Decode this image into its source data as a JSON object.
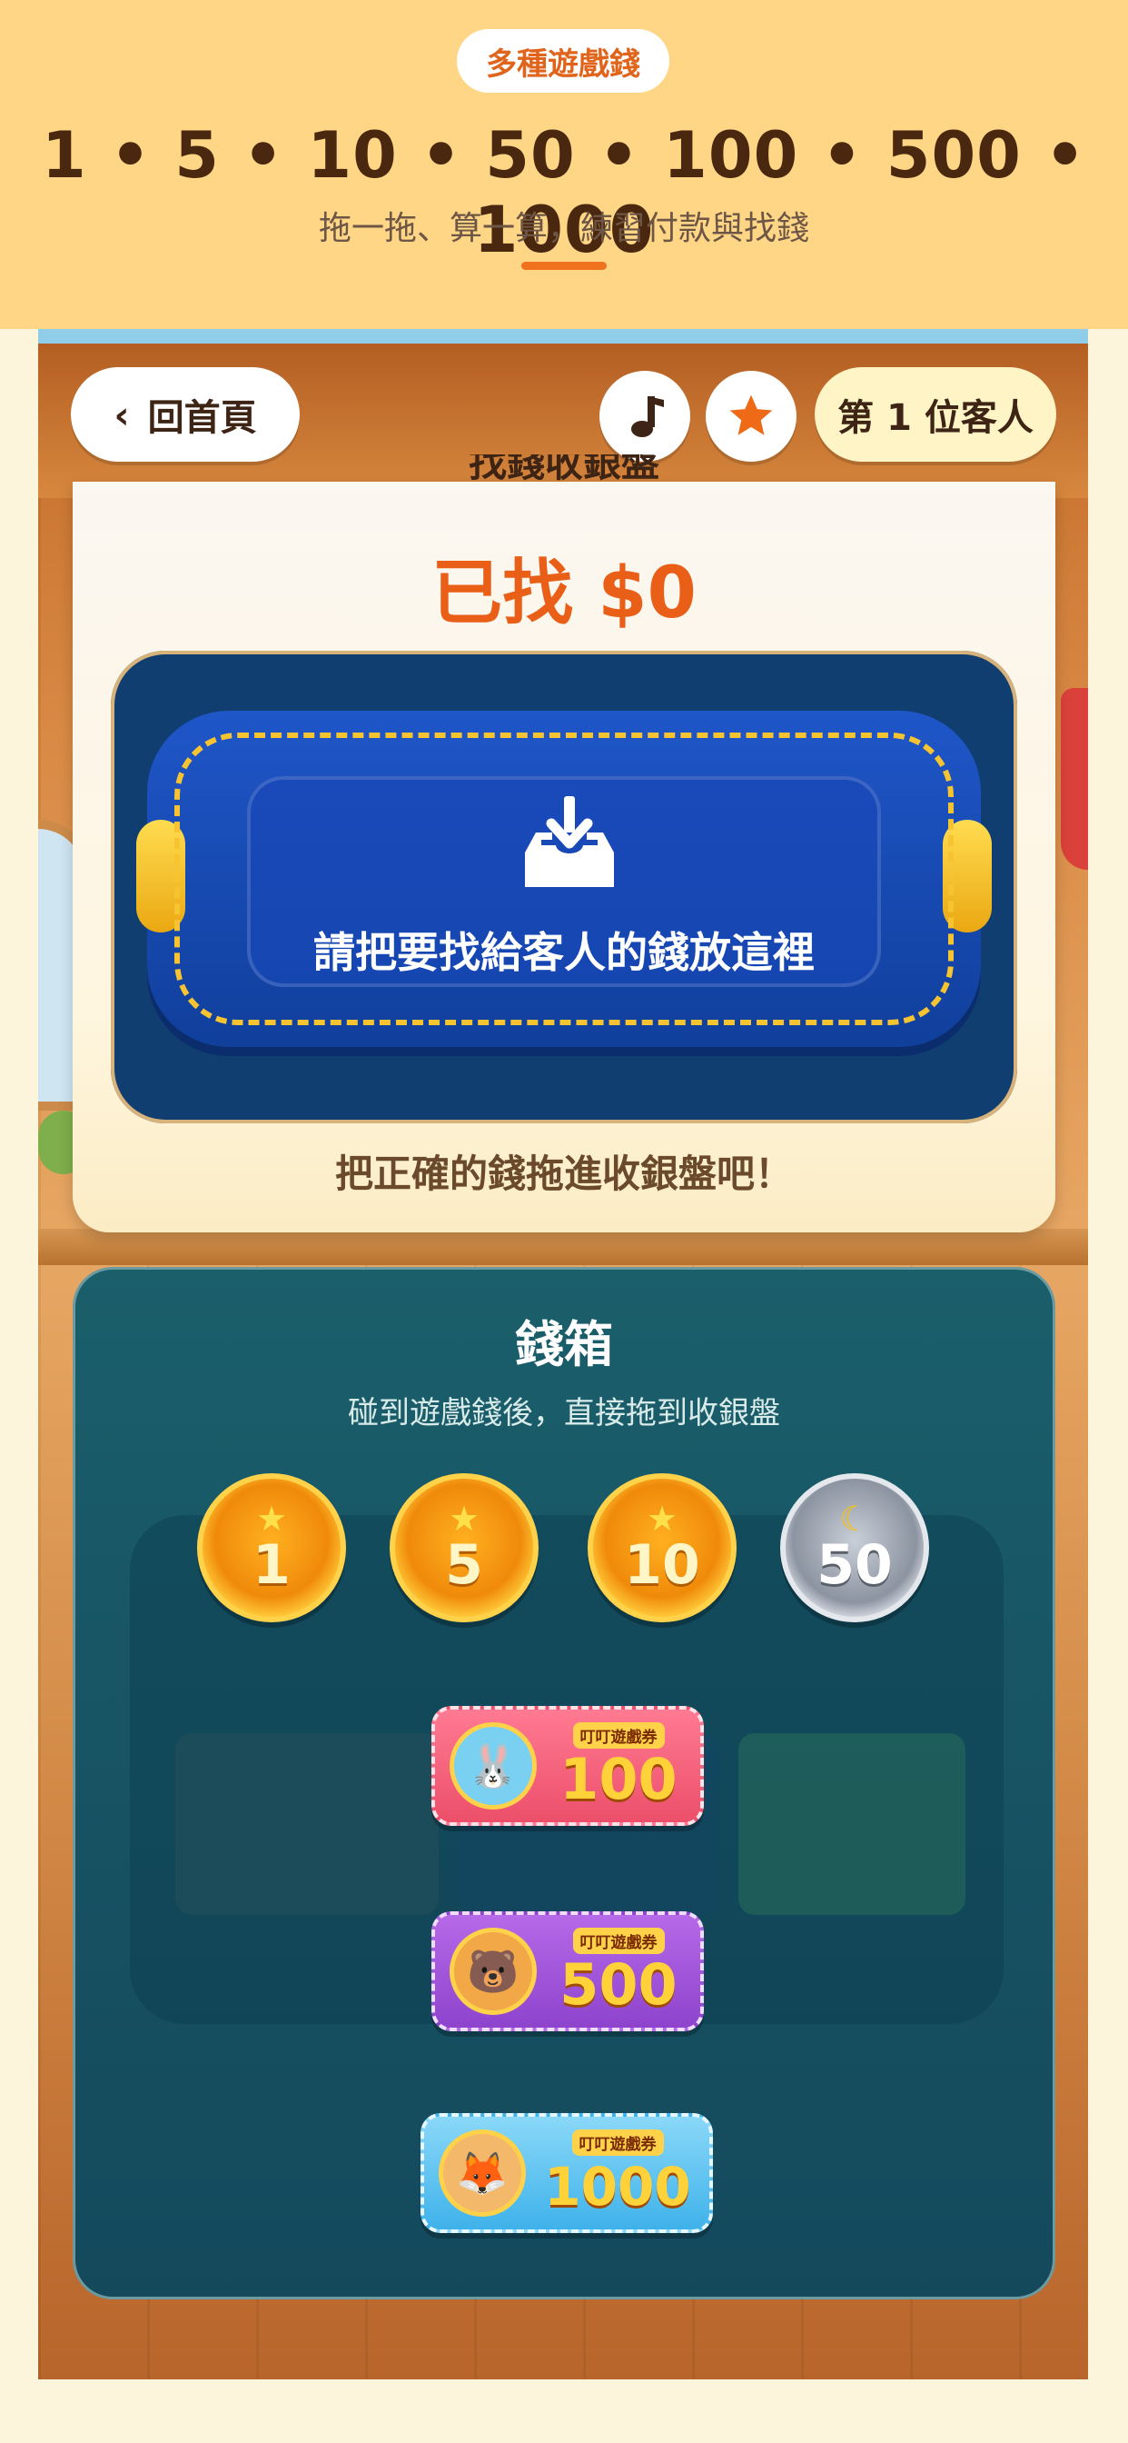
{
  "banner": {
    "pill": "多種遊戲錢",
    "denominations": "1 • 5 • 10 • 50 • 100 • 500 • 1000",
    "subtitle": "拖一拖、算一算，練習付款與找錢"
  },
  "header": {
    "home_label": "回首頁",
    "customer_label": "第 1 位客人"
  },
  "tray": {
    "peek_title": "找錢收銀盤",
    "found_text": "已找 $0",
    "dropzone_label": "請把要找給客人的錢放這裡",
    "hint": "把正確的錢拖進收銀盤吧！"
  },
  "money_box": {
    "title": "錢箱",
    "subtitle": "碰到遊戲錢後，直接拖到收銀盤",
    "coins": [
      {
        "value": "1",
        "kind": "gold",
        "icon": "star-icon"
      },
      {
        "value": "5",
        "kind": "gold",
        "icon": "star-icon"
      },
      {
        "value": "10",
        "kind": "gold",
        "icon": "star-icon"
      },
      {
        "value": "50",
        "kind": "silver",
        "icon": "moon-icon"
      }
    ],
    "tickets": [
      {
        "value": "100",
        "tag": "叮叮遊戲券",
        "mascot": "bunny"
      },
      {
        "value": "500",
        "tag": "叮叮遊戲券",
        "mascot": "bear"
      },
      {
        "value": "1000",
        "tag": "叮叮遊戲券",
        "mascot": "fox"
      }
    ]
  },
  "colors": {
    "banner_bg": "#fed686",
    "accent_orange": "#e95f18",
    "tray_blue": "#103e70",
    "box_teal": "#175464"
  }
}
